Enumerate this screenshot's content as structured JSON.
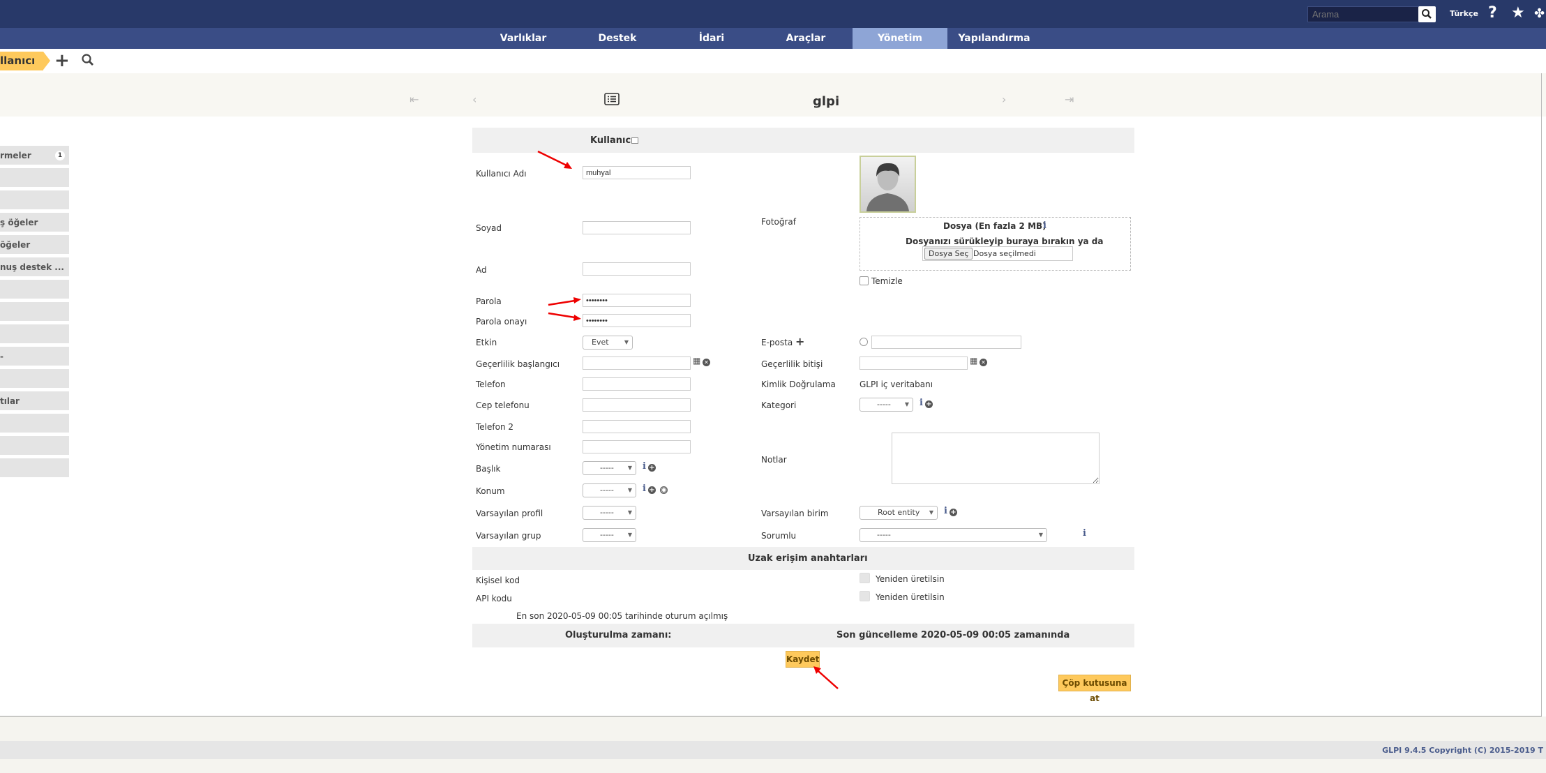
{
  "topbar": {
    "search_placeholder": "Arama",
    "language": "Türkçe",
    "help_icon": "question-icon",
    "star_icon": "star-icon",
    "puzzle_icon": "puzzle-icon"
  },
  "nav": {
    "items": [
      "Varlıklar",
      "Destek",
      "İdari",
      "Araçlar",
      "Yönetim",
      "Yapılandırma"
    ],
    "active": "Yönetim"
  },
  "breadcrumb": {
    "current": "llanıcı"
  },
  "record": {
    "title": "glpi"
  },
  "left_tabs": [
    {
      "label": "rmeler",
      "badge": "1"
    },
    {
      "label": ""
    },
    {
      "label": ""
    },
    {
      "label": "ş öğeler"
    },
    {
      "label": "öğeler"
    },
    {
      "label": "nuş destek ..."
    },
    {
      "label": ""
    },
    {
      "label": ""
    },
    {
      "label": ""
    },
    {
      "label": "-"
    },
    {
      "label": ""
    },
    {
      "label": "tılar"
    },
    {
      "label": ""
    },
    {
      "label": ""
    },
    {
      "label": ""
    }
  ],
  "form": {
    "header": "Kullanıcı",
    "username_label": "Kullanıcı Adı",
    "username_value": "muhyal",
    "surname_label": "Soyad",
    "firstname_label": "Ad",
    "password_label": "Parola",
    "password_value": "••••••••",
    "password_confirm_label": "Parola onayı",
    "password_confirm_value": "••••••••",
    "photo_label": "Fotoğraf",
    "file_title": "Dosya (En fazla 2 MB)",
    "file_drop_text": "Dosyanızı sürükleyip buraya bırakın ya da",
    "file_choose_button": "Dosya Seç",
    "file_none": "Dosya seçilmedi",
    "clear_label": "Temizle",
    "active_label": "Etkin",
    "active_value": "Evet",
    "email_label": "E-posta",
    "valid_from_label": "Geçerlilik başlangıcı",
    "valid_to_label": "Geçerlilik bitişi",
    "phone_label": "Telefon",
    "auth_label": "Kimlik Doğrulama",
    "auth_value": "GLPI iç veritabanı",
    "mobile_label": "Cep telefonu",
    "category_label": "Kategori",
    "category_value": "-----",
    "phone2_label": "Telefon 2",
    "admin_number_label": "Yönetim numarası",
    "notes_label": "Notlar",
    "title_label": "Başlık",
    "title_value": "-----",
    "location_label": "Konum",
    "location_value": "-----",
    "default_profile_label": "Varsayılan profil",
    "default_profile_value": "-----",
    "default_entity_label": "Varsayılan birim",
    "default_entity_value": "Root entity",
    "default_group_label": "Varsayılan grup",
    "default_group_value": "-----",
    "supervisor_label": "Sorumlu",
    "supervisor_value": "-----",
    "remote_keys_header": "Uzak erişim anahtarları",
    "personal_token_label": "Kişisel kod",
    "regenerate_label": "Yeniden üretilsin",
    "api_token_label": "API kodu",
    "last_login": "En son 2020-05-09 00:05 tarihinde oturum açılmış",
    "created_label": "Oluşturulma zamanı:",
    "updated_label": "Son güncelleme 2020-05-09 00:05 zamanında",
    "save_button": "Kaydet",
    "trash_button": "Çöp kutusuna at"
  },
  "footer": {
    "copyright": "GLPI 9.4.5 Copyright (C) 2015-2019 T"
  },
  "colors": {
    "topbar": "#283969",
    "nav": "#3a4d86",
    "nav_active": "#8ea5d6",
    "accent": "#fec95c"
  }
}
